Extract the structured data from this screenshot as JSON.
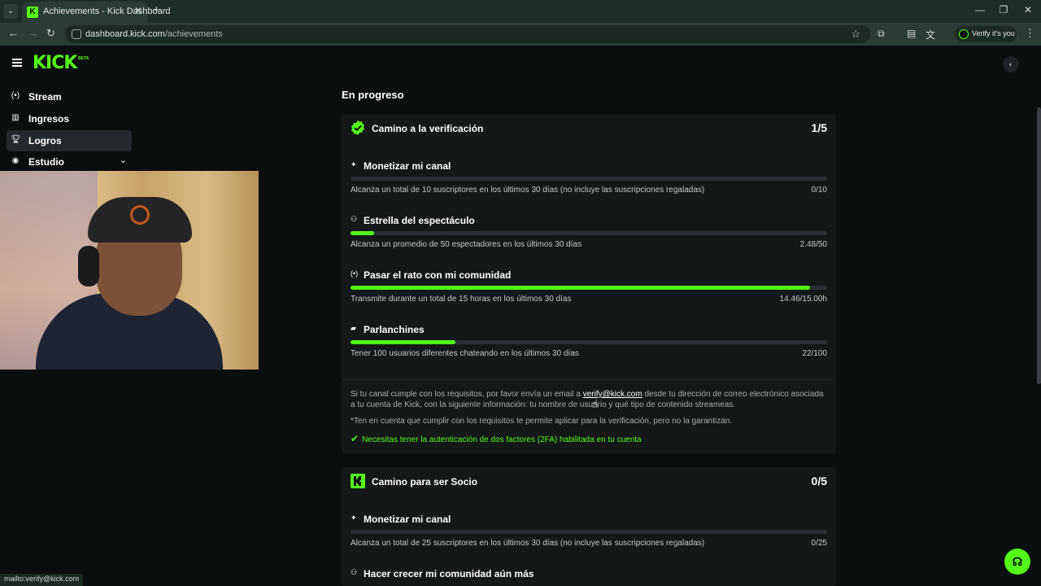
{
  "browser": {
    "tab_title": "Achievements - Kick Dashboard",
    "url_domain": "dashboard.kick.com",
    "url_path": "/achievements",
    "profile_label": "Verify it's you",
    "status_link": "mailto:verify@kick.com"
  },
  "header": {
    "logo_text": "KICK",
    "logo_badge": "BETA"
  },
  "sidebar": {
    "items": [
      {
        "label": "Stream",
        "icon": "broadcast-icon"
      },
      {
        "label": "Ingresos",
        "icon": "chart-icon"
      },
      {
        "label": "Logros",
        "icon": "trophy-icon",
        "active": true
      },
      {
        "label": "Estudio",
        "icon": "camera-icon",
        "expandable": true
      }
    ]
  },
  "main": {
    "section_title": "En progreso",
    "cards": [
      {
        "title": "Camino a la verificación",
        "count": "1/5",
        "tasks": [
          {
            "title": "Monetizar mi canal",
            "desc": "Alcanza un total de 10 suscriptores en los últimos 30 días (no incluye las suscripciones regaladas)",
            "value": "0/10",
            "progress": 0
          },
          {
            "title": "Estrella del espectáculo",
            "desc": "Alcanza un promedio de 50 espectadores en los últimos 30 días",
            "value": "2.48/50",
            "progress": 0.05
          },
          {
            "title": "Pasar el rato con mi comunidad",
            "desc": "Transmite durante un total de 15 horas en los últimos 30 días",
            "value": "14.46/15.00h",
            "progress": 0.964
          },
          {
            "title": "Parlanchines",
            "desc": "Tener 100 usuarios diferentes chateando en los últimos 30 días",
            "value": "22/100",
            "progress": 0.22
          }
        ],
        "note_before": "Si tu canal cumple con los requisitos, por favor envía un email a",
        "note_email": "verify@kick.com",
        "note_after_1": "desde tu dirección de correo electrónico asociada",
        "note_after_2": "a tu cuenta de Kick, con la siguiente información: tu nombre de usuario y qué tipo de contenido streameas.",
        "disclaimer": "*Ten en cuenta que cumplir con los requisitos te permite aplicar para la verificación, pero no la garantizan.",
        "twofa": "Necesitas tener la autenticación de dos factores (2FA) habilitada en tu cuenta"
      },
      {
        "title": "Camino para ser Socio",
        "count": "0/5",
        "tasks": [
          {
            "title": "Monetizar mi canal",
            "desc": "Alcanza un total de 25 suscriptores en los últimos 30 días (no incluye las suscripciones regaladas)",
            "value": "0/25",
            "progress": 0
          },
          {
            "title": "Hacer crecer mi comunidad aún más",
            "desc": "",
            "value": "",
            "progress": 0
          }
        ]
      }
    ]
  },
  "colors": {
    "accent": "#53fc18",
    "background": "#0b0e0f",
    "card": "#141819"
  }
}
